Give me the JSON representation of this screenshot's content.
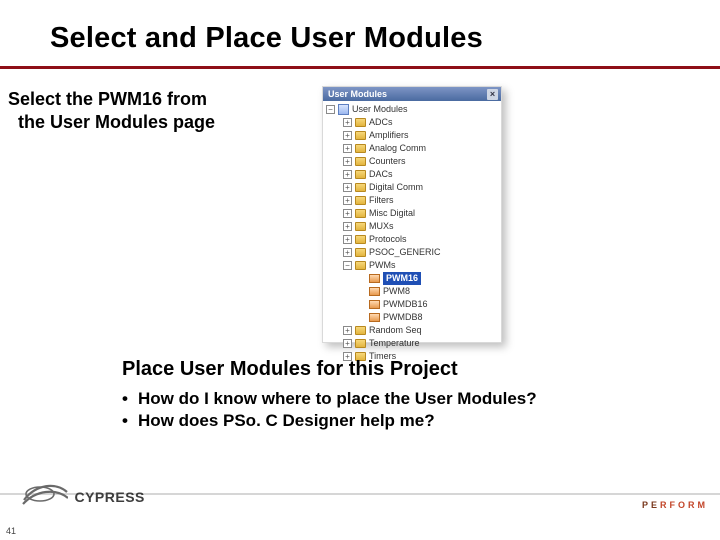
{
  "title": "Select and Place User Modules",
  "subtitle_line1": "Select the PWM16 from",
  "subtitle_line2": "the User Modules page",
  "panel": {
    "header": "User Modules",
    "root": "User Modules",
    "categories": [
      "ADCs",
      "Amplifiers",
      "Analog Comm",
      "Counters",
      "DACs",
      "Digital Comm",
      "Filters",
      "Misc Digital",
      "MUXs",
      "Protocols",
      "PSOC_GENERIC",
      "PWMs"
    ],
    "pwms_children": [
      {
        "label": "PWM16",
        "selected": true
      },
      {
        "label": "PWM8",
        "selected": false
      },
      {
        "label": "PWMDB16",
        "selected": false
      },
      {
        "label": "PWMDB8",
        "selected": false
      }
    ],
    "after_pwms": [
      "Random Seq",
      "Temperature",
      "Timers"
    ]
  },
  "sub2": "Place User Modules for this Project",
  "bullets": [
    "How do I know where to place the User Modules?",
    "How does PSo. C Designer help me?"
  ],
  "footer": {
    "logo_text": "CYPRESS",
    "perform": "PERFORM"
  },
  "page_number": "41"
}
